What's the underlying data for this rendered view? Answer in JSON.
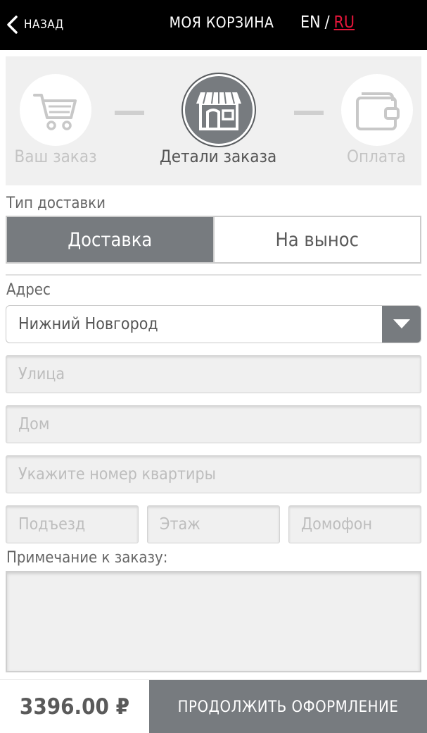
{
  "header": {
    "back_label": "НАЗАД",
    "title": "МОЯ КОРЗИНА",
    "lang_en": "EN",
    "lang_separator": "/",
    "lang_ru": "RU"
  },
  "steps": [
    {
      "label": "Ваш заказ",
      "icon": "cart-icon",
      "state": "inactive"
    },
    {
      "label": "Детали заказа",
      "icon": "store-icon",
      "state": "active"
    },
    {
      "label": "Оплата",
      "icon": "wallet-icon",
      "state": "inactive"
    }
  ],
  "delivery": {
    "label": "Тип доставки",
    "options": [
      "Доставка",
      "На вынос"
    ],
    "selected": "Доставка"
  },
  "address": {
    "label": "Адрес",
    "city": "Нижний Новгород",
    "street_placeholder": "Улица",
    "house_placeholder": "Дом",
    "apartment_placeholder": "Укажите номер квартиры",
    "entrance_placeholder": "Подъезд",
    "floor_placeholder": "Этаж",
    "intercom_placeholder": "Домофон"
  },
  "note": {
    "label": "Примечание к заказу:",
    "value": ""
  },
  "footer": {
    "price": "3396.00 ₽",
    "continue_label": "ПРОДОЛЖИТЬ ОФОРМЛЕНИЕ"
  },
  "colors": {
    "accent_gray": "#777b7f",
    "active_lang": "#e4163a",
    "header_bg": "#000000"
  }
}
